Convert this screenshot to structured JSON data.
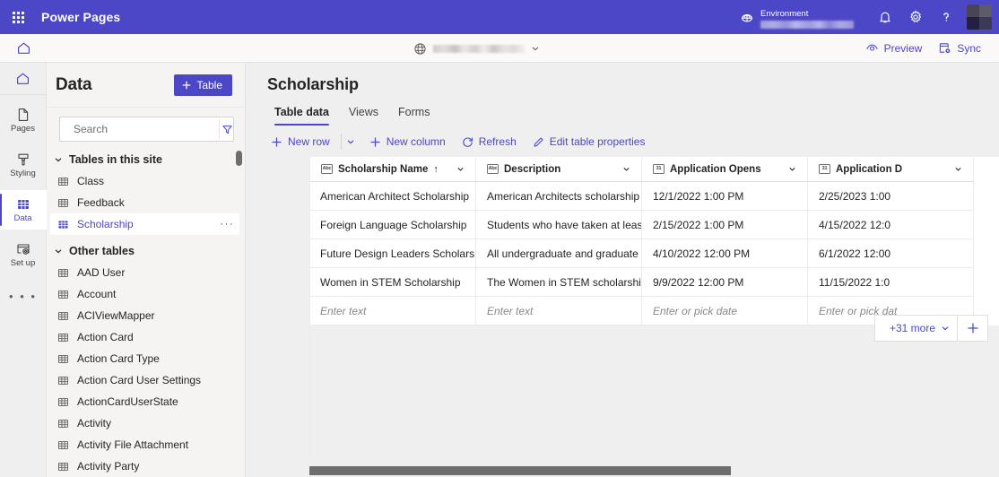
{
  "suitebar": {
    "waffle_name": "app-launcher",
    "title": "Power Pages",
    "env_label": "Environment",
    "env_value": "",
    "icons": {
      "globe": "globe-icon",
      "notifications": "bell-icon",
      "settings": "gear-icon",
      "help": "question-icon",
      "avatar": "avatar"
    },
    "accent": "#4b47c6"
  },
  "sitebar": {
    "home": "home-icon",
    "site_name": "",
    "preview_label": "Preview",
    "sync_label": "Sync"
  },
  "rail": {
    "items": [
      {
        "label": "Pages",
        "icon": "page-icon",
        "active": false
      },
      {
        "label": "Styling",
        "icon": "brush-icon",
        "active": false
      },
      {
        "label": "Data",
        "icon": "table-grid-icon",
        "active": true
      },
      {
        "label": "Set up",
        "icon": "setup-icon",
        "active": false
      }
    ],
    "more_label": "• • •"
  },
  "datapanel": {
    "title": "Data",
    "new_table_label": "Table",
    "search_placeholder": "Search",
    "search_value": "",
    "groups": [
      {
        "label": "Tables in this site",
        "expanded": true,
        "items": [
          {
            "label": "Class",
            "selected": false
          },
          {
            "label": "Feedback",
            "selected": false
          },
          {
            "label": "Scholarship",
            "selected": true,
            "overflow": "···"
          }
        ]
      },
      {
        "label": "Other tables",
        "expanded": true,
        "items": [
          {
            "label": "AAD User",
            "selected": false
          },
          {
            "label": "Account",
            "selected": false
          },
          {
            "label": "ACIViewMapper",
            "selected": false
          },
          {
            "label": "Action Card",
            "selected": false
          },
          {
            "label": "Action Card Type",
            "selected": false
          },
          {
            "label": "Action Card User Settings",
            "selected": false
          },
          {
            "label": "ActionCardUserState",
            "selected": false
          },
          {
            "label": "Activity",
            "selected": false
          },
          {
            "label": "Activity File Attachment",
            "selected": false
          },
          {
            "label": "Activity Party",
            "selected": false
          }
        ]
      }
    ]
  },
  "main": {
    "title": "Scholarship",
    "tabs": [
      {
        "label": "Table data",
        "active": true
      },
      {
        "label": "Views",
        "active": false
      },
      {
        "label": "Forms",
        "active": false
      }
    ],
    "commands": [
      {
        "label": "New row",
        "icon": "plus-icon",
        "has_split": true
      },
      {
        "label": "New column",
        "icon": "plus-icon",
        "has_split": false
      },
      {
        "label": "Refresh",
        "icon": "refresh-icon",
        "has_split": false
      },
      {
        "label": "Edit table properties",
        "icon": "pencil-icon",
        "has_split": false
      }
    ],
    "grid": {
      "columns": [
        {
          "label": "Scholarship Name",
          "type_icon": "Abc",
          "sorted": "asc",
          "sort_glyph": "↑"
        },
        {
          "label": "Description",
          "type_icon": "Abc",
          "sorted": "",
          "sort_glyph": ""
        },
        {
          "label": "Application Opens",
          "type_icon": "31",
          "sorted": "",
          "sort_glyph": ""
        },
        {
          "label": "Application D",
          "type_icon": "31",
          "sorted": "",
          "sort_glyph": ""
        }
      ],
      "rows": [
        [
          "American Architect Scholarship",
          "American Architects scholarship is…",
          "12/1/2022 1:00 PM",
          "2/25/2023 1:00"
        ],
        [
          "Foreign Language Scholarship",
          "Students who have taken at least …",
          "2/15/2022 1:00 PM",
          "4/15/2022 12:0"
        ],
        [
          "Future Design Leaders Scholarship",
          "All undergraduate and graduate s…",
          "4/10/2022 12:00 PM",
          "6/1/2022 12:00"
        ],
        [
          "Women in STEM Scholarship",
          "The Women in STEM scholarship i…",
          "9/9/2022 12:00 PM",
          "11/15/2022 1:0"
        ]
      ],
      "new_row_placeholders": [
        "Enter text",
        "Enter text",
        "Enter or pick date",
        "Enter or pick dat"
      ],
      "more_columns_label": "+31 more",
      "add_column_label": "+"
    }
  }
}
